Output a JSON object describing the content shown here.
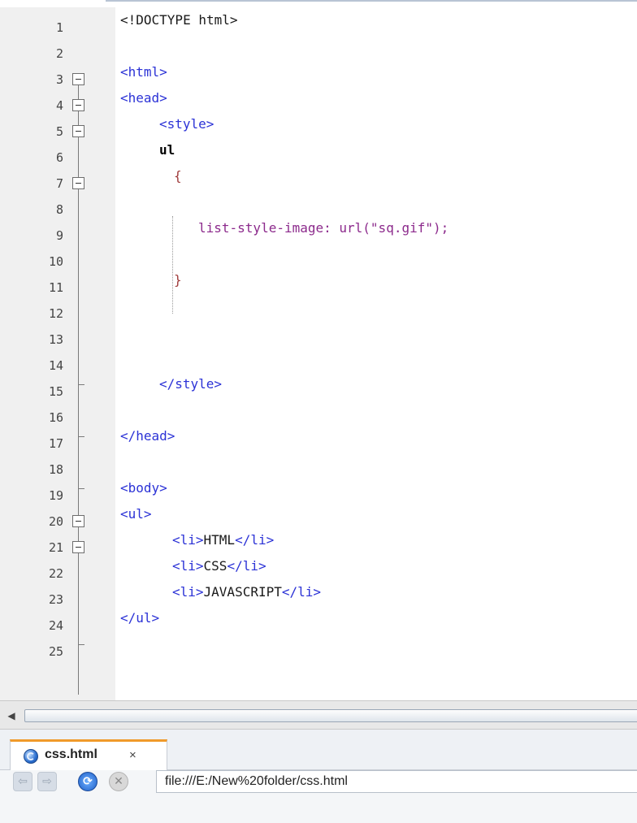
{
  "editor": {
    "line_numbers": [
      "1",
      "2",
      "3",
      "4",
      "5",
      "6",
      "7",
      "8",
      "9",
      "10",
      "11",
      "12",
      "13",
      "14",
      "15",
      "16",
      "17",
      "18",
      "19",
      "20",
      "21",
      "22",
      "23",
      "24",
      "25"
    ],
    "code": {
      "l1": "<!DOCTYPE html>",
      "l3": "<html>",
      "l4": "<head>",
      "l5": "<style>",
      "l6": "ul",
      "l7": "{",
      "l9": "list-style-image: url(\"sq.gif\");",
      "l11": "}",
      "l15": "</style>",
      "l17": "</head>",
      "l19": "<body>",
      "l20": "<ul>",
      "l21_open": "<li>",
      "l21_text": "HTML",
      "l21_close": "</li>",
      "l22_open": "<li>",
      "l22_text": "CSS",
      "l22_close": "</li>",
      "l23_open": "<li>",
      "l23_text": "JAVASCRIPT",
      "l23_close": "</li>",
      "l24": "</ul>"
    }
  },
  "scrollbar": {
    "left_arrow": "◀"
  },
  "browser": {
    "tab": {
      "label": "css.html",
      "close": "×",
      "favicon": "globe-icon"
    },
    "nav": {
      "back": "⇦",
      "forward": "⇨",
      "reload": "⟳",
      "stop": "✕"
    },
    "url": "file:///E:/New%20folder/css.html"
  },
  "colors": {
    "tag": "#2b32d6",
    "property": "#8c2a8c",
    "brace": "#a03c3c",
    "tab_accent": "#f09a2a"
  }
}
